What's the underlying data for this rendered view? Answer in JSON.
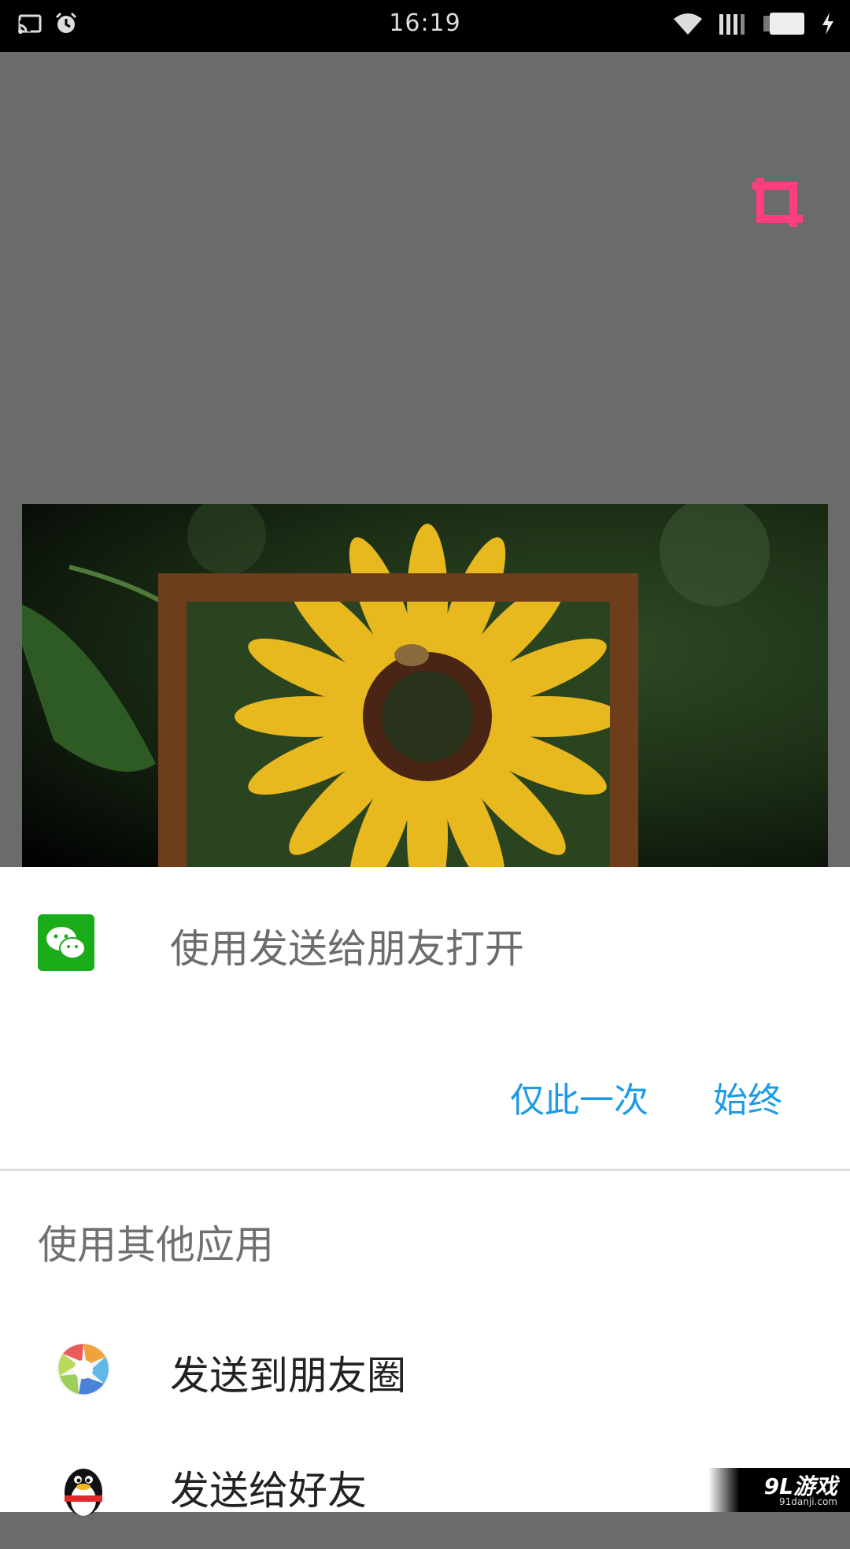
{
  "status_bar": {
    "time": "16:19"
  },
  "dialog": {
    "open_with_title": "使用发送给朋友打开",
    "just_once_label": "仅此一次",
    "always_label": "始终",
    "other_apps_title": "使用其他应用",
    "apps": [
      {
        "label": "发送到朋友圈",
        "icon": "moments-icon"
      },
      {
        "label": "发送给好友",
        "icon": "qq-penguin-icon"
      }
    ]
  },
  "watermark": {
    "logo": "9L游戏",
    "url": "91danji.com"
  },
  "colors": {
    "accent": "#1e9be6",
    "crop_icon": "#ff3d7f",
    "wechat_green": "#1aad19",
    "frame_brown": "#6e3d1c"
  }
}
